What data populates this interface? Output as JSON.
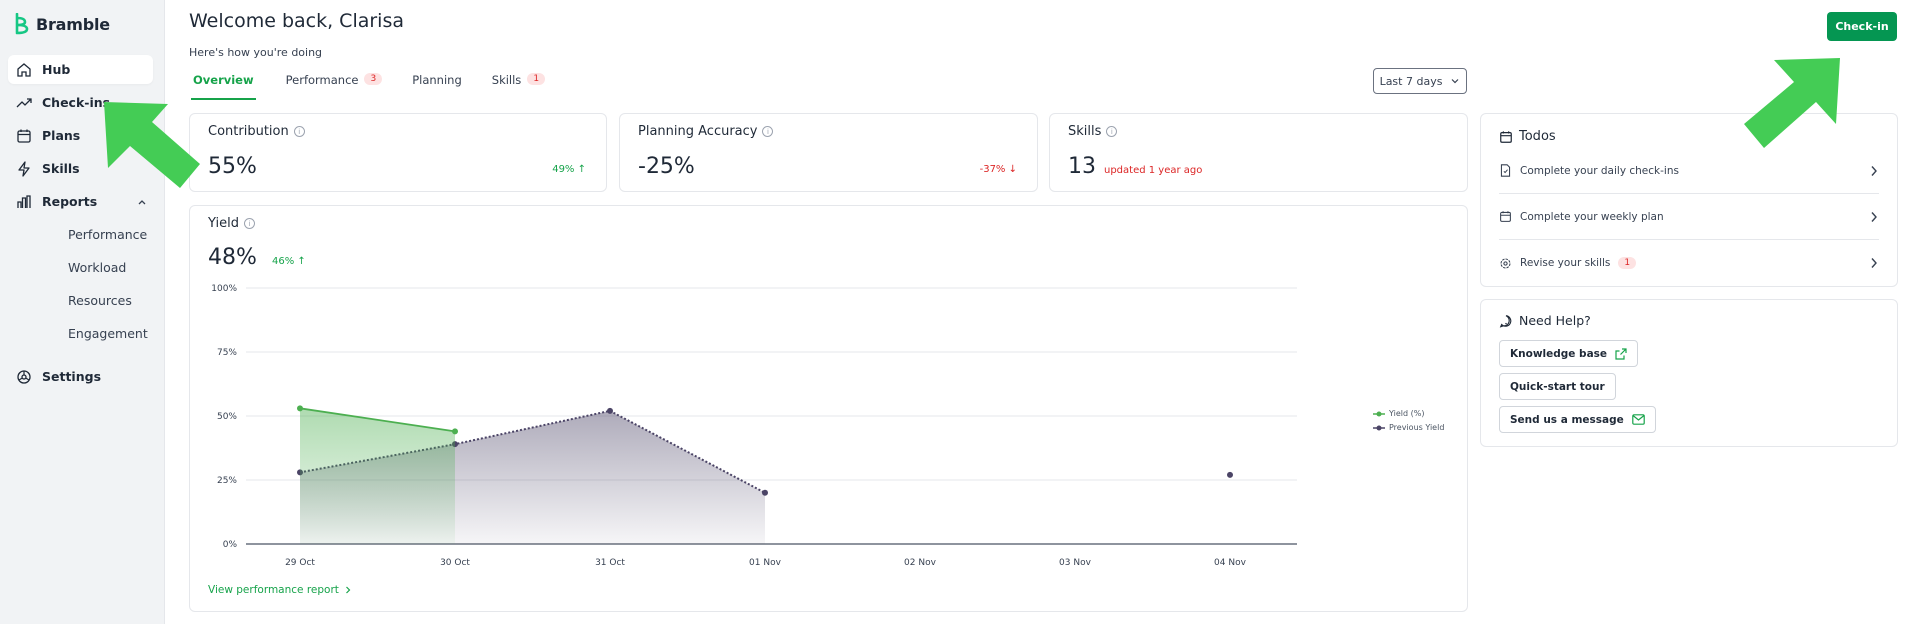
{
  "brand": {
    "name": "Bramble",
    "color": "#16c784"
  },
  "sidebar": {
    "items": [
      {
        "label": "Hub",
        "icon": "home-icon",
        "active": true
      },
      {
        "label": "Check-ins",
        "icon": "trend-icon"
      },
      {
        "label": "Plans",
        "icon": "calendar-icon"
      },
      {
        "label": "Skills",
        "icon": "bolt-icon"
      },
      {
        "label": "Reports",
        "icon": "bar-chart-icon",
        "expanded": true
      }
    ],
    "reports_sub": [
      "Performance",
      "Workload",
      "Resources",
      "Engagement"
    ],
    "settings": {
      "label": "Settings",
      "icon": "settings-icon"
    }
  },
  "header": {
    "welcome": "Welcome back, Clarisa",
    "subtitle": "Here's how you're doing",
    "checkin_button": "Check-in",
    "range": "Last 7 days"
  },
  "tabs": [
    {
      "label": "Overview",
      "active": true
    },
    {
      "label": "Performance",
      "badge": "3"
    },
    {
      "label": "Planning"
    },
    {
      "label": "Skills",
      "badge": "1"
    }
  ],
  "cards": {
    "contribution": {
      "title": "Contribution",
      "value": "55%",
      "delta": "49% ↑"
    },
    "planning": {
      "title": "Planning Accuracy",
      "value": "-25%",
      "delta": "-37% ↓"
    },
    "skills": {
      "title": "Skills",
      "value": "13",
      "note": "updated 1 year ago"
    },
    "yield": {
      "title": "Yield",
      "value": "48%",
      "delta": "46% ↑",
      "link": "View performance report"
    }
  },
  "todos": {
    "title": "Todos",
    "items": [
      {
        "label": "Complete your daily check-ins",
        "icon": "document-icon"
      },
      {
        "label": "Complete your weekly plan",
        "icon": "calendar-icon"
      },
      {
        "label": "Revise your skills",
        "icon": "gear-icon",
        "badge": "1"
      }
    ]
  },
  "help": {
    "title": "Need Help?",
    "buttons": [
      {
        "label": "Knowledge base",
        "icon": "external-link-icon"
      },
      {
        "label": "Quick-start tour"
      },
      {
        "label": "Send us a message",
        "icon": "mail-icon"
      }
    ]
  },
  "chart_data": {
    "type": "area",
    "categories": [
      "29 Oct",
      "30 Oct",
      "31 Oct",
      "01 Nov",
      "02 Nov",
      "03 Nov",
      "04 Nov"
    ],
    "y_ticks": [
      "0%",
      "25%",
      "50%",
      "75%",
      "100%"
    ],
    "ylim": [
      0,
      100
    ],
    "series": [
      {
        "name": "Yield (%)",
        "color": "#4caf50",
        "values": [
          53,
          44,
          null,
          null,
          null,
          null,
          null
        ]
      },
      {
        "name": "Previous Yield",
        "color": "#4b4466",
        "values": [
          28,
          39,
          52,
          20,
          null,
          null,
          27
        ]
      }
    ],
    "legend": "right",
    "grid": true
  },
  "colors": {
    "accent": "#16a34a",
    "primary_button": "#059652",
    "arrow": "#44cc55",
    "badge_bg": "#fde2e2",
    "badge_text": "#dc2626"
  }
}
